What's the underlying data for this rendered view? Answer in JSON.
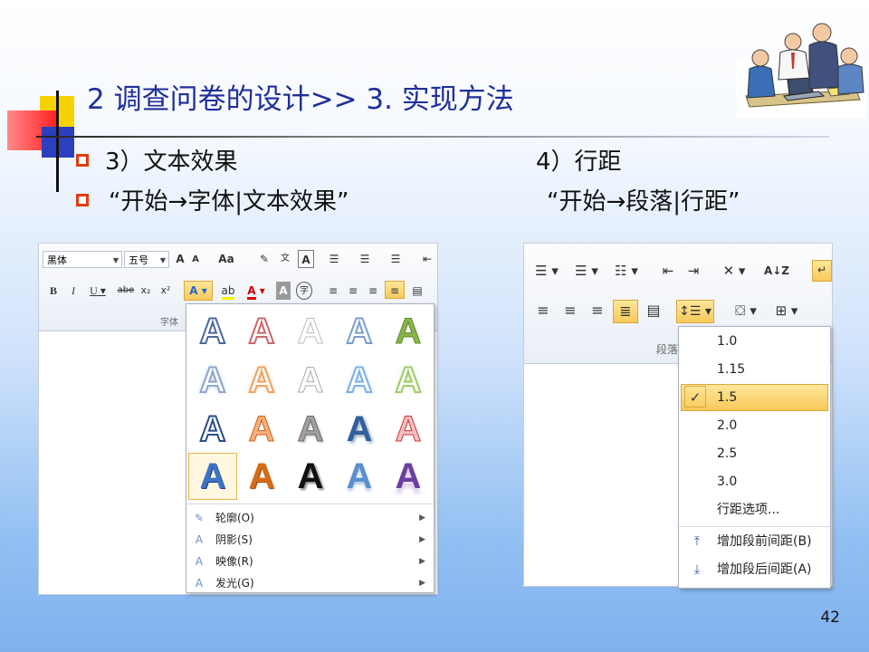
{
  "slide": {
    "title": "2 调查问卷的设计>> 3. 实现方法",
    "bullets": [
      {
        "left": "3）文本效果",
        "right": "4）行距"
      },
      {
        "left": "“开始→字体|文本效果”",
        "right": "“开始→段落|行距”"
      }
    ],
    "page_number": "42"
  },
  "font_ribbon": {
    "font_name": "黑体",
    "font_size": "五号",
    "grow_font": "A",
    "shrink_font": "A",
    "change_case": "Aa",
    "bold": "B",
    "italic": "I",
    "underline": "U",
    "strikethrough": "abe",
    "subscript": "x₂",
    "superscript": "x²",
    "font_color": "A",
    "char_shading": "A",
    "enclose_char": "字",
    "group_label": "字体"
  },
  "text_effects_gallery": {
    "style_letter": "A",
    "menu_items": [
      {
        "label": "轮廓(O)",
        "icon": "pen-outline-icon"
      },
      {
        "label": "阴影(S)",
        "icon": "shadow-icon"
      },
      {
        "label": "映像(R)",
        "icon": "reflection-icon"
      },
      {
        "label": "发光(G)",
        "icon": "glow-icon"
      }
    ]
  },
  "paragraph_ribbon": {
    "group_label": "段落",
    "sort_label": "A↓Z"
  },
  "line_spacing_menu": {
    "options": [
      "1.0",
      "1.15",
      "1.5",
      "2.0",
      "2.5",
      "3.0"
    ],
    "selected": "1.5",
    "more_options": "行距选项...",
    "add_space_before": "增加段前间距(B)",
    "add_space_after": "增加段后间距(A)"
  },
  "colors": {
    "title_blue": "#1f2f9a",
    "bullet_red": "#e23b10",
    "highlight_gold": "#f7c95c"
  }
}
